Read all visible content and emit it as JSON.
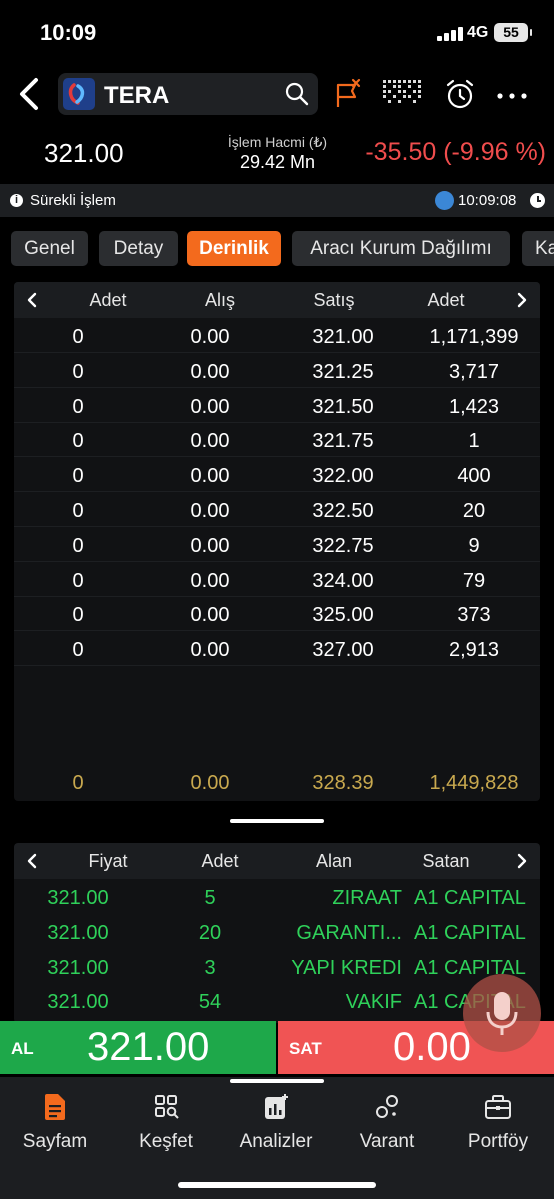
{
  "status": {
    "time": "10:09",
    "network": "4G",
    "battery": "55"
  },
  "header": {
    "symbol": "TERA"
  },
  "quote": {
    "price": "321.00",
    "volume_label": "İşlem Hacmi (₺)",
    "volume_value": "29.42 Mn",
    "change": "-35.50 (-9.96 %)",
    "change_color": "#f04d4d"
  },
  "session": {
    "label": "Sürekli İşlem",
    "time": "10:09:08"
  },
  "tabs": [
    {
      "label": "Genel"
    },
    {
      "label": "Detay"
    },
    {
      "label": "Derinlik"
    },
    {
      "label": "Aracı Kurum Dağılımı"
    },
    {
      "label": "Ka"
    }
  ],
  "depth": {
    "headers": [
      "Adet",
      "Alış",
      "Satış",
      "Adet"
    ],
    "rows": [
      [
        "0",
        "0.00",
        "321.00",
        "1,171,399"
      ],
      [
        "0",
        "0.00",
        "321.25",
        "3,717"
      ],
      [
        "0",
        "0.00",
        "321.50",
        "1,423"
      ],
      [
        "0",
        "0.00",
        "321.75",
        "1"
      ],
      [
        "0",
        "0.00",
        "322.00",
        "400"
      ],
      [
        "0",
        "0.00",
        "322.50",
        "20"
      ],
      [
        "0",
        "0.00",
        "322.75",
        "9"
      ],
      [
        "0",
        "0.00",
        "324.00",
        "79"
      ],
      [
        "0",
        "0.00",
        "325.00",
        "373"
      ],
      [
        "0",
        "0.00",
        "327.00",
        "2,913"
      ]
    ],
    "totals": [
      "0",
      "0.00",
      "328.39",
      "1,449,828"
    ]
  },
  "trades": {
    "headers": [
      "Fiyat",
      "Adet",
      "Alan",
      "Satan"
    ],
    "rows": [
      [
        "321.00",
        "5",
        "ZIRAAT",
        "A1 CAPITAL"
      ],
      [
        "321.00",
        "20",
        "GARANTI...",
        "A1 CAPITAL"
      ],
      [
        "321.00",
        "3",
        "YAPI KREDI",
        "A1 CAPITAL"
      ],
      [
        "321.00",
        "54",
        "VAKIF",
        "A1 CAPITAL"
      ]
    ]
  },
  "order_bar": {
    "buy_label": "AL",
    "buy_price": "321.00",
    "sell_label": "SAT",
    "sell_price": "0.00",
    "buy_color": "#1ea84a",
    "sell_color": "#f05454"
  },
  "bottom_nav": [
    {
      "label": "Sayfam",
      "icon": "document-icon"
    },
    {
      "label": "Keşfet",
      "icon": "discover-grid-icon"
    },
    {
      "label": "Analizler",
      "icon": "analysis-chart-icon"
    },
    {
      "label": "Varant",
      "icon": "warrant-circles-icon"
    },
    {
      "label": "Portföy",
      "icon": "briefcase-icon"
    }
  ],
  "colors": {
    "accent": "#f36a1d",
    "trade_green": "#2fd15a",
    "total_gold": "#c9a94f"
  }
}
